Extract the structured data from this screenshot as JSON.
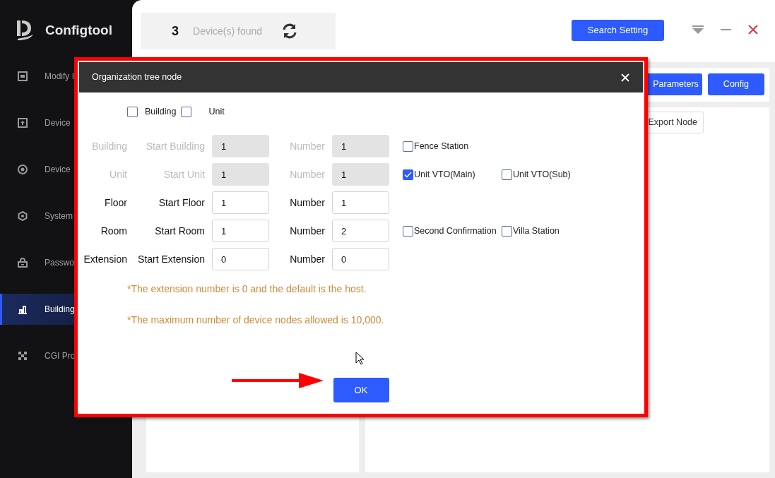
{
  "app": {
    "logo": "Configtool"
  },
  "sidebar": {
    "items": [
      {
        "label": "Modify I",
        "selected": false
      },
      {
        "label": "Device",
        "selected": false
      },
      {
        "label": "Device",
        "selected": false
      },
      {
        "label": "System",
        "selected": false
      },
      {
        "label": "Passwo",
        "selected": false
      },
      {
        "label": "Building",
        "selected": true
      },
      {
        "label": "CGI Pro",
        "selected": false
      }
    ]
  },
  "header": {
    "device_count": "3",
    "device_label": "Device(s) found",
    "search_button": "Search Setting"
  },
  "toolbar": {
    "buttons": [
      "Parameters",
      "Config"
    ],
    "export_button": "Export Node"
  },
  "dialog": {
    "title": "Organization tree node",
    "type_options": [
      {
        "label": "Building",
        "checked": false
      },
      {
        "label": "Unit",
        "checked": false
      }
    ],
    "rows": [
      {
        "label": "Building",
        "start_label": "Start Building",
        "start_value": "1",
        "number_label": "Number",
        "number_value": "1",
        "disabled": true,
        "options": [
          {
            "label": "Fence Station",
            "checked": false
          }
        ]
      },
      {
        "label": "Unit",
        "start_label": "Start Unit",
        "start_value": "1",
        "number_label": "Number",
        "number_value": "1",
        "disabled": true,
        "options": [
          {
            "label": "Unit VTO(Main)",
            "checked": true
          },
          {
            "label": "Unit VTO(Sub)",
            "checked": false
          }
        ]
      },
      {
        "label": "Floor",
        "start_label": "Start Floor",
        "start_value": "1",
        "number_label": "Number",
        "number_value": "1",
        "disabled": false
      },
      {
        "label": "Room",
        "start_label": "Start Room",
        "start_value": "1",
        "number_label": "Number",
        "number_value": "2",
        "disabled": false,
        "options": [
          {
            "label": "Second Confirmation",
            "checked": false
          },
          {
            "label": "Villa Station",
            "checked": false
          }
        ]
      },
      {
        "label": "Extension",
        "start_label": "Start Extension",
        "start_value": "0",
        "number_label": "Number",
        "number_value": "0",
        "disabled": false
      }
    ],
    "notes": [
      "*The extension number is 0 and the default is the host.",
      "*The maximum number of device nodes allowed is 10,000."
    ],
    "ok_button": "OK"
  }
}
